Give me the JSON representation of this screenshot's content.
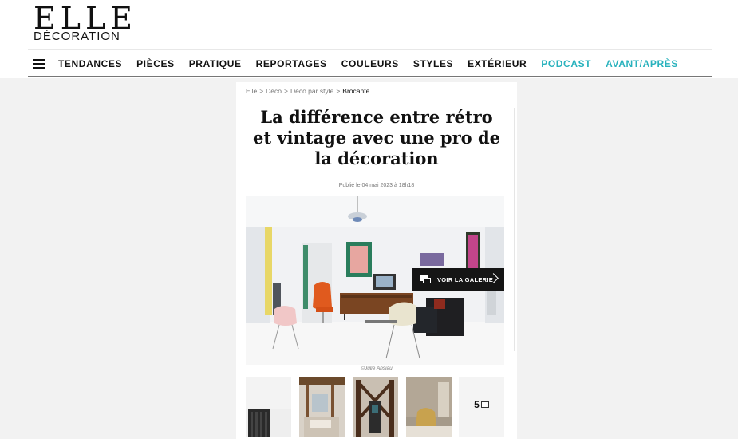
{
  "header": {
    "logo_main": "ELLE",
    "logo_sub": "DÉCORATION"
  },
  "nav": {
    "items": [
      {
        "label": "TENDANCES"
      },
      {
        "label": "PIÈCES"
      },
      {
        "label": "PRATIQUE"
      },
      {
        "label": "REPORTAGES"
      },
      {
        "label": "COULEURS"
      },
      {
        "label": "STYLES"
      },
      {
        "label": "EXTÉRIEUR"
      },
      {
        "label": "PODCAST"
      },
      {
        "label": "AVANT/APRÈS"
      }
    ],
    "accent_color": "#28b2bd",
    "menu_icon": "hamburger-icon"
  },
  "article": {
    "breadcrumb": [
      "Elle",
      "Déco",
      "Déco par style",
      "Brocante"
    ],
    "breadcrumb_separator": ">",
    "title": "La différence entre rétro et vintage avec une pro de la décoration",
    "published": "Publié le 04 mai 2023 à 18h18",
    "gallery_button": "VOIR LA GALERIE",
    "photo_credit": "©Julie Ansiau",
    "more_count": "5"
  }
}
